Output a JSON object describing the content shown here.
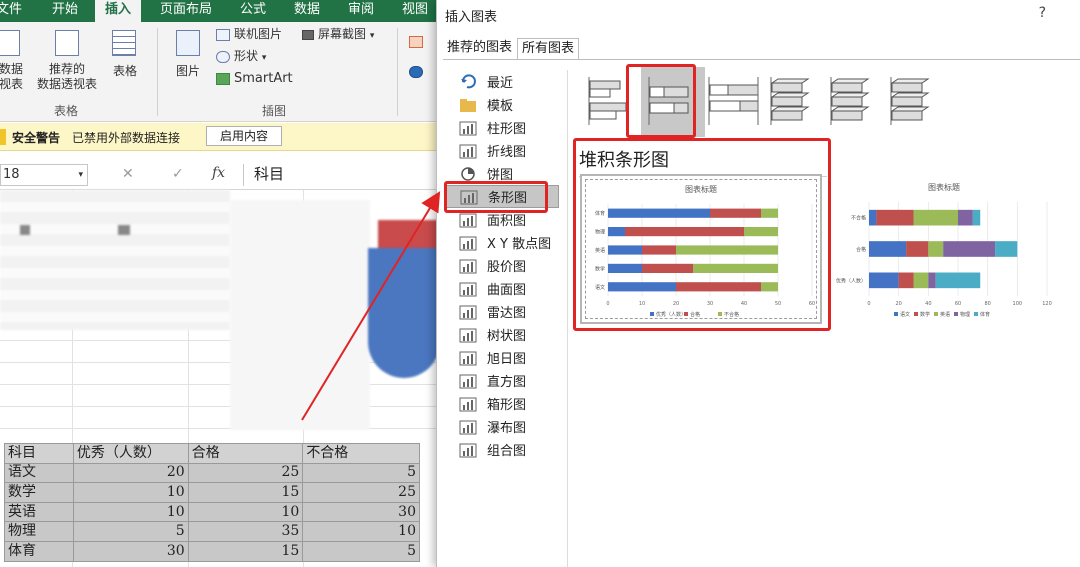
{
  "excel": {
    "tabs": [
      "文件",
      "开始",
      "插入",
      "页面布局",
      "公式",
      "数据",
      "审阅",
      "视图"
    ],
    "active_tab": "插入",
    "ribbon": {
      "pivot_partial_label": [
        "数据",
        "视表"
      ],
      "recommended_pivot_label": [
        "推荐的",
        "数据透视表"
      ],
      "table_label": "表格",
      "tables_group_label": "表格",
      "picture_label": "图片",
      "online_picture_label": "联机图片",
      "shapes_label": "形状",
      "smartart_label": "SmartArt",
      "screenshot_label": "屏幕截图",
      "illustrations_group_label": "插图"
    },
    "warning": {
      "title": "安全警告",
      "message": "已禁用外部数据连接",
      "button": "启用内容"
    },
    "formula_bar": {
      "name_box": "18",
      "fx": "fx",
      "content": "科目"
    },
    "table": {
      "headers": [
        "科目",
        "优秀（人数）",
        "合格",
        "不合格"
      ],
      "rows": [
        {
          "subject": "语文",
          "excellent": "20",
          "pass": "25",
          "fail": "5"
        },
        {
          "subject": "数学",
          "excellent": "10",
          "pass": "15",
          "fail": "25"
        },
        {
          "subject": "英语",
          "excellent": "10",
          "pass": "10",
          "fail": "30"
        },
        {
          "subject": "物理",
          "excellent": "5",
          "pass": "35",
          "fail": "10"
        },
        {
          "subject": "体育",
          "excellent": "30",
          "pass": "15",
          "fail": "5"
        }
      ]
    }
  },
  "dialog": {
    "title": "插入图表",
    "help": "?",
    "tabs": [
      "推荐的图表",
      "所有图表"
    ],
    "active_tab": "所有图表",
    "categories": [
      {
        "label": "最近",
        "icon": "recent-icon"
      },
      {
        "label": "模板",
        "icon": "folder-icon"
      },
      {
        "label": "柱形图",
        "icon": "column-chart-icon"
      },
      {
        "label": "折线图",
        "icon": "line-chart-icon"
      },
      {
        "label": "饼图",
        "icon": "pie-chart-icon"
      },
      {
        "label": "条形图",
        "icon": "bar-chart-icon"
      },
      {
        "label": "面积图",
        "icon": "area-chart-icon"
      },
      {
        "label": "X Y 散点图",
        "icon": "scatter-chart-icon"
      },
      {
        "label": "股价图",
        "icon": "stock-chart-icon"
      },
      {
        "label": "曲面图",
        "icon": "surface-chart-icon"
      },
      {
        "label": "雷达图",
        "icon": "radar-chart-icon"
      },
      {
        "label": "树状图",
        "icon": "treemap-chart-icon"
      },
      {
        "label": "旭日图",
        "icon": "sunburst-chart-icon"
      },
      {
        "label": "直方图",
        "icon": "histogram-chart-icon"
      },
      {
        "label": "箱形图",
        "icon": "boxplot-chart-icon"
      },
      {
        "label": "瀑布图",
        "icon": "waterfall-chart-icon"
      },
      {
        "label": "组合图",
        "icon": "combo-chart-icon"
      }
    ],
    "selected_category": "条形图",
    "selected_subtype_index": 1,
    "selected_chart_name": "堆积条形图",
    "colors": {
      "accent_red": "#e02424",
      "blue": "#4472c4",
      "red": "#c0504d",
      "green": "#9bbb59",
      "purple": "#8064a2",
      "cyan": "#4bacc6"
    }
  },
  "chart_data": [
    {
      "type": "bar",
      "stacked": true,
      "orientation": "horizontal",
      "title": "图表标题",
      "categories": [
        "语文",
        "数学",
        "英语",
        "物理",
        "体育"
      ],
      "series": [
        {
          "name": "优秀（人数）",
          "values": [
            20,
            10,
            10,
            5,
            30
          ]
        },
        {
          "name": "合格",
          "values": [
            25,
            15,
            10,
            35,
            15
          ]
        },
        {
          "name": "不合格",
          "values": [
            5,
            25,
            30,
            10,
            5
          ]
        }
      ],
      "xlim": [
        0,
        60
      ],
      "xticks": [
        "0",
        "10",
        "20",
        "30",
        "40",
        "50",
        "60"
      ],
      "legend": "bottom"
    },
    {
      "type": "bar",
      "stacked": true,
      "orientation": "horizontal",
      "title": "图表标题",
      "categories": [
        "优秀（人数）",
        "合格",
        "不合格"
      ],
      "series": [
        {
          "name": "语文",
          "values": [
            20,
            25,
            5
          ]
        },
        {
          "name": "数学",
          "values": [
            10,
            15,
            25
          ]
        },
        {
          "name": "英语",
          "values": [
            10,
            10,
            30
          ]
        },
        {
          "name": "物理",
          "values": [
            5,
            35,
            10
          ]
        },
        {
          "name": "体育",
          "values": [
            30,
            15,
            5
          ]
        }
      ],
      "xlim": [
        0,
        120
      ],
      "xticks": [
        "0",
        "20",
        "40",
        "60",
        "80",
        "100",
        "120"
      ],
      "legend": "bottom"
    }
  ]
}
